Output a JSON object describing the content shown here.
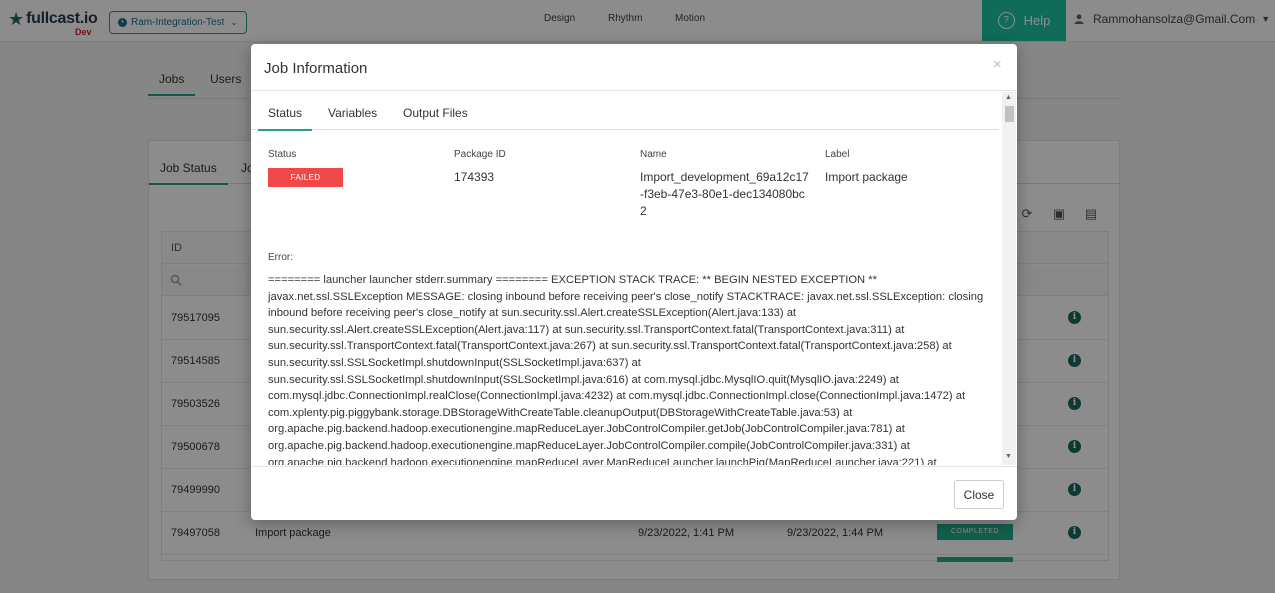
{
  "navbar": {
    "logo_text": "fullcast.io",
    "env_badge": "Dev",
    "org_name": "Ram-Integration-Test",
    "nav_links": [
      "Design",
      "Rhythm",
      "Motion"
    ],
    "help_label": "Help",
    "user_email": "Rammohansolza@Gmail.Com"
  },
  "page": {
    "top_tabs": [
      "Jobs",
      "Users"
    ],
    "card_tabs": [
      "Job Status",
      "Jo"
    ],
    "table": {
      "header_id": "ID",
      "rows": [
        {
          "id": "79517095",
          "description": "",
          "started": "",
          "ended": "",
          "status": ""
        },
        {
          "id": "79514585",
          "description": "",
          "started": "",
          "ended": "",
          "status": ""
        },
        {
          "id": "79503526",
          "description": "",
          "started": "",
          "ended": "",
          "status": ""
        },
        {
          "id": "79500678",
          "description": "",
          "started": "",
          "ended": "",
          "status": ""
        },
        {
          "id": "79499990",
          "description": "",
          "started": "",
          "ended": "",
          "status": ""
        },
        {
          "id": "79497058",
          "description": "Import package",
          "started": "9/23/2022, 1:41 PM",
          "ended": "9/23/2022, 1:44 PM",
          "status": "COMPLETED"
        }
      ]
    }
  },
  "modal": {
    "title": "Job Information",
    "close_x": "×",
    "tabs": [
      "Status",
      "Variables",
      "Output Files"
    ],
    "fields": {
      "status_label": "Status",
      "status_value": "FAILED",
      "package_id_label": "Package ID",
      "package_id_value": "174393",
      "name_label": "Name",
      "name_value": "Import_development_69a12c17-f3eb-47e3-80e1-dec134080bc2",
      "label_label": "Label",
      "label_value": "Import package"
    },
    "error_label": "Error:",
    "error_text": "======== launcher launcher stderr.summary ======== EXCEPTION STACK TRACE: ** BEGIN NESTED EXCEPTION ** javax.net.ssl.SSLException MESSAGE: closing inbound before receiving peer's close_notify STACKTRACE: javax.net.ssl.SSLException: closing inbound before receiving peer's close_notify at sun.security.ssl.Alert.createSSLException(Alert.java:133) at sun.security.ssl.Alert.createSSLException(Alert.java:117) at sun.security.ssl.TransportContext.fatal(TransportContext.java:311) at sun.security.ssl.TransportContext.fatal(TransportContext.java:267) at sun.security.ssl.TransportContext.fatal(TransportContext.java:258) at sun.security.ssl.SSLSocketImpl.shutdownInput(SSLSocketImpl.java:637) at sun.security.ssl.SSLSocketImpl.shutdownInput(SSLSocketImpl.java:616) at com.mysql.jdbc.MysqlIO.quit(MysqlIO.java:2249) at com.mysql.jdbc.ConnectionImpl.realClose(ConnectionImpl.java:4232) at com.mysql.jdbc.ConnectionImpl.close(ConnectionImpl.java:1472) at com.xplenty.pig.piggybank.storage.DBStorageWithCreateTable.cleanupOutput(DBStorageWithCreateTable.java:53) at org.apache.pig.backend.hadoop.executionengine.mapReduceLayer.JobControlCompiler.getJob(JobControlCompiler.java:781) at org.apache.pig.backend.hadoop.executionengine.mapReduceLayer.JobControlCompiler.compile(JobControlCompiler.java:331) at org.apache.pig.backend.hadoop.executionengine.mapReduceLayer.MapReduceLauncher.launchPig(MapReduceLauncher.java:221) at",
    "close_button": "Close"
  },
  "colors": {
    "brand_teal": "#1cc5a0",
    "failed_red": "#f04848",
    "completed_green": "#20b08e",
    "tab_underline": "#2a9d8f"
  }
}
